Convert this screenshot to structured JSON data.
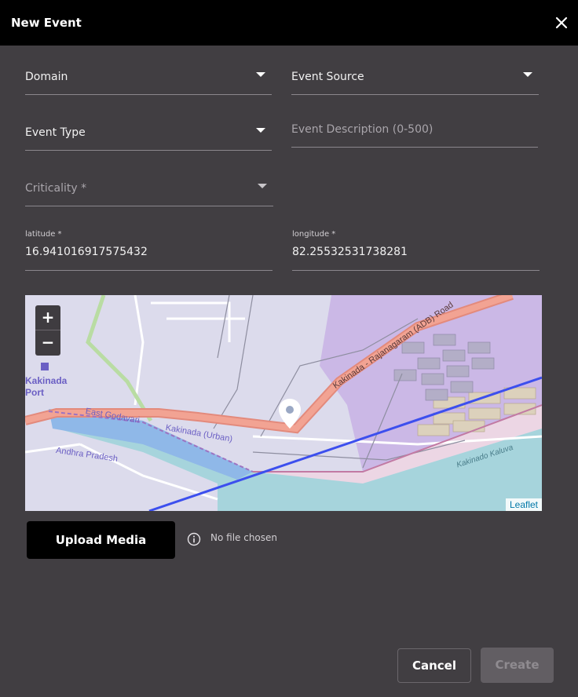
{
  "dialog": {
    "title": "New Event",
    "close_icon": "close-icon"
  },
  "form": {
    "domain": {
      "label": "Domain"
    },
    "event_source": {
      "label": "Event Source"
    },
    "event_type": {
      "label": "Event Type"
    },
    "event_description": {
      "placeholder": "Event Description (0-500)"
    },
    "criticality": {
      "label": "Criticality *"
    },
    "latitude": {
      "label": "latitude *",
      "value": "16.941016917575432"
    },
    "longitude": {
      "label": "longitude *",
      "value": "82.25532531738281"
    }
  },
  "map": {
    "labels": {
      "port": "Kakinada Port",
      "road": "Kakinada - Rajanagaram (ADB) Road",
      "godavari": "East Godavari",
      "urban": "Kakinada (Urban)",
      "state": "Andhra Pradesh",
      "kaluva": "Kakinado Kaluva"
    },
    "zoom_in": "+",
    "zoom_out": "−",
    "attribution": "Leaflet",
    "marker_icon": "location-pin-icon"
  },
  "upload": {
    "button": "Upload Media",
    "info_icon": "info-icon",
    "status": "No file chosen"
  },
  "actions": {
    "cancel": "Cancel",
    "create": "Create"
  }
}
